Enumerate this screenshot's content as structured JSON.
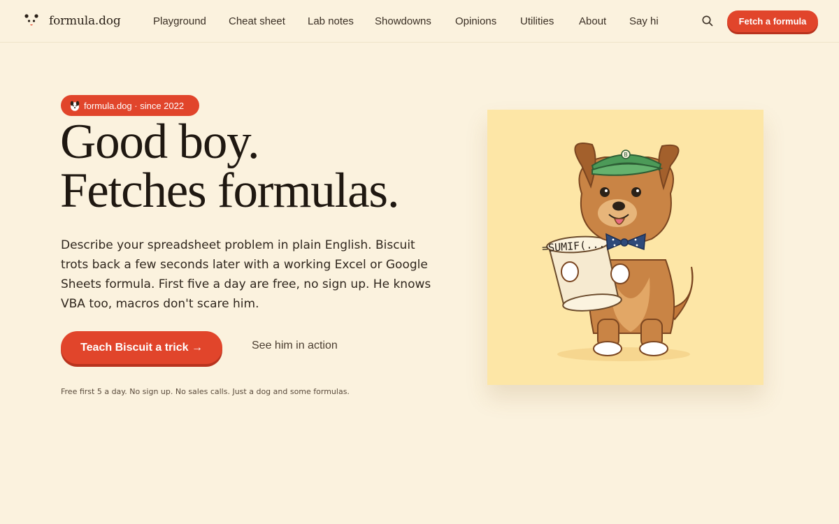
{
  "brand": {
    "name": "formula.dog",
    "icon": "dog-face-icon"
  },
  "nav": {
    "items": [
      {
        "label": "Playground"
      },
      {
        "label": "Cheat sheet"
      },
      {
        "label": "Lab notes"
      },
      {
        "label": "Showdowns"
      },
      {
        "label": "Opinions"
      },
      {
        "label": "Utilities"
      },
      {
        "label": "About"
      },
      {
        "label": "Say hi"
      }
    ]
  },
  "header": {
    "search_icon": "search-icon",
    "cta_label": "Fetch a formula"
  },
  "hero": {
    "badge_label": "formula.dog · since 2022",
    "badge_icon": "dog-icon",
    "headline_line1": "Good boy.",
    "headline_line2": "Fetches formulas.",
    "lede": "Describe your spreadsheet problem in plain English. Biscuit trots back a few seconds later with a working Excel or Google Sheets formula. First five a day are free, no sign up. He knows VBA too, macros don't scare him.",
    "primary_cta": "Teach Biscuit a trick →",
    "secondary_cta": "See him in action",
    "fineprint": "Free first 5 a day. No sign up. No sales calls. Just a dog and some formulas."
  },
  "illustration": {
    "scroll_text": "=SUMIF(...)",
    "visor_badge": "B"
  },
  "colors": {
    "background": "#fbf2de",
    "accent": "#e1452b",
    "art_background": "#fde6a6"
  }
}
